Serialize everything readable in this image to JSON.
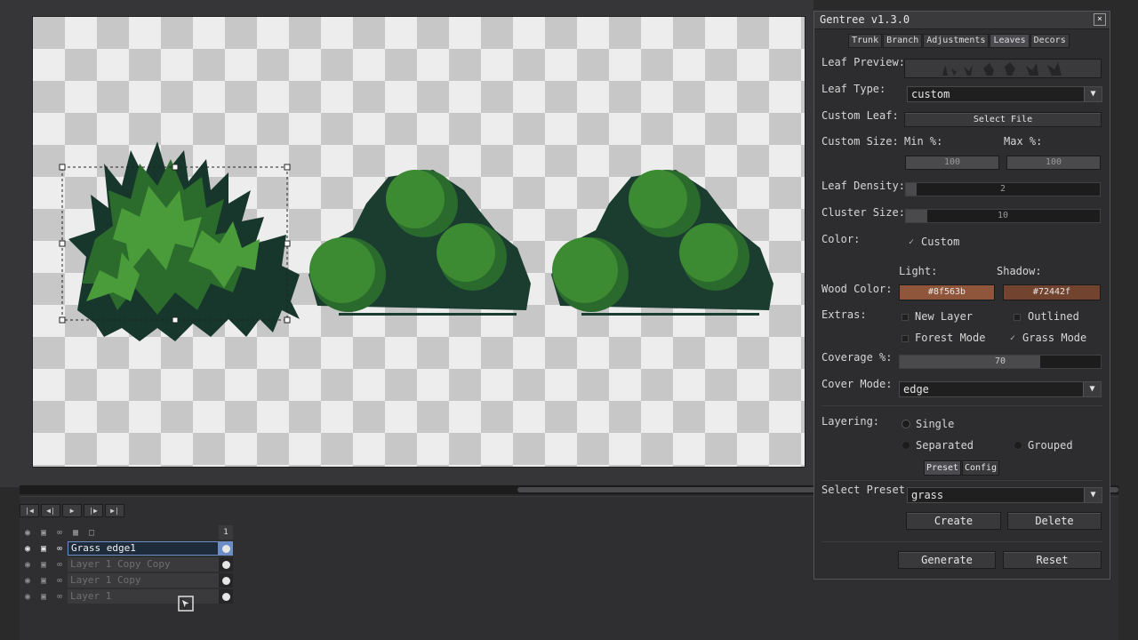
{
  "panel": {
    "title": "Gentree v1.3.0",
    "close": "×",
    "tabs": [
      {
        "label": "Trunk"
      },
      {
        "label": "Branch"
      },
      {
        "label": "Adjustments"
      },
      {
        "label": "Leaves",
        "active": true
      },
      {
        "label": "Decors"
      }
    ],
    "leaf_preview_label": "Leaf Preview:",
    "leaf_type_label": "Leaf Type:",
    "leaf_type_value": "custom",
    "custom_leaf_label": "Custom Leaf:",
    "select_file": "Select File",
    "custom_size_label": "Custom Size:",
    "min_label": "Min %:",
    "max_label": "Max %:",
    "min_value": "100",
    "max_value": "100",
    "leaf_density_label": "Leaf Density:",
    "leaf_density_value": "2",
    "cluster_size_label": "Cluster Size:",
    "cluster_size_value": "10",
    "color_label": "Color:",
    "custom_check_label": "Custom",
    "light_label": "Light:",
    "shadow_label": "Shadow:",
    "wood_color_label": "Wood Color:",
    "wood_light": "#8f563b",
    "wood_shadow": "#72442f",
    "extras_label": "Extras:",
    "new_layer": "New Layer",
    "outlined": "Outlined",
    "forest_mode": "Forest Mode",
    "grass_mode": "Grass Mode",
    "coverage_label": "Coverage %:",
    "coverage_value": "70",
    "cover_mode_label": "Cover Mode:",
    "cover_mode_value": "edge",
    "layering_label": "Layering:",
    "single": "Single",
    "separated": "Separated",
    "grouped": "Grouped",
    "preset_tab": "Preset",
    "config_tab": "Config",
    "select_preset_label": "Select Preset:",
    "preset_value": "grass",
    "create": "Create",
    "delete": "Delete",
    "generate": "Generate",
    "reset": "Reset"
  },
  "timeline": {
    "frame_number": "1",
    "layers": [
      {
        "name": "Grass edge1",
        "active": true
      },
      {
        "name": "Layer 1 Copy Copy"
      },
      {
        "name": "Layer 1 Copy"
      },
      {
        "name": "Layer 1"
      }
    ]
  },
  "icons": {
    "dropdown": "▼",
    "check": "✓",
    "eye": "◉",
    "lock": "🔒",
    "link": "∞",
    "first": "|◀",
    "prev": "◀|",
    "play": "▶",
    "next": "|▶",
    "last": "▶|"
  },
  "colors": {
    "grass_dark": "#17372c",
    "grass_mid": "#2b6b2c",
    "grass_light": "#4a9b3a",
    "blob_light": "#3c8a32",
    "blob_dark": "#1b3d30",
    "wood_light": "#8f563b",
    "wood_shadow": "#72442f"
  }
}
